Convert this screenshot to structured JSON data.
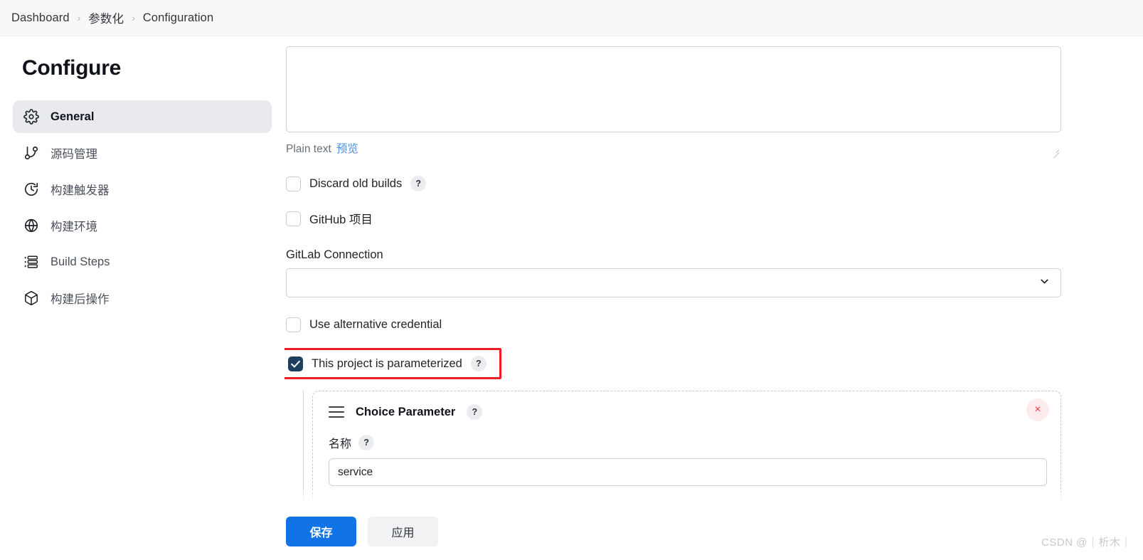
{
  "breadcrumb": {
    "items": [
      {
        "label": "Dashboard"
      },
      {
        "label": "参数化"
      },
      {
        "label": "Configuration"
      }
    ],
    "separator": "›"
  },
  "sidebar": {
    "title": "Configure",
    "items": [
      {
        "label": "General",
        "icon": "gear-icon",
        "active": true
      },
      {
        "label": "源码管理",
        "icon": "git-branch-icon",
        "active": false
      },
      {
        "label": "构建触发器",
        "icon": "clock-icon",
        "active": false
      },
      {
        "label": "构建环境",
        "icon": "globe-icon",
        "active": false
      },
      {
        "label": "Build Steps",
        "icon": "list-steps-icon",
        "active": false
      },
      {
        "label": "构建后操作",
        "icon": "package-icon",
        "active": false
      }
    ]
  },
  "main": {
    "description": {
      "value": "",
      "placeholder": "",
      "format_label": "Plain text",
      "preview_link": "预览"
    },
    "discard_old_builds": {
      "label": "Discard old builds",
      "checked": false,
      "help": "?"
    },
    "github_project": {
      "label": "GitHub 项目",
      "checked": false
    },
    "gitlab_connection": {
      "label": "GitLab Connection",
      "value": "",
      "chevron": "chevron-down-icon"
    },
    "use_alternative_credential": {
      "label": "Use alternative credential",
      "checked": false
    },
    "parameterized": {
      "label": "This project is parameterized",
      "checked": true,
      "help": "?",
      "highlight_color": "#ee1c24"
    },
    "parameter_card": {
      "title": "Choice Parameter",
      "help": "?",
      "remove_label": "×",
      "name_label": "名称",
      "name_help": "?",
      "name_value": "service"
    }
  },
  "footer": {
    "save_label": "保存",
    "apply_label": "应用",
    "save_color": "#1273e6"
  },
  "watermark": {
    "text": "CSDN @｜析木｜"
  }
}
